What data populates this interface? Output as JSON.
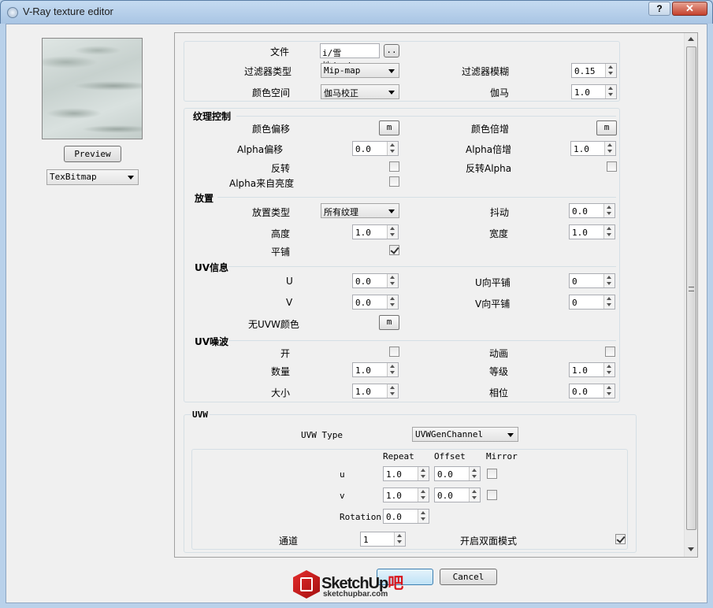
{
  "window": {
    "title": "V-Ray texture editor",
    "help_label": "?",
    "close_label": "✕"
  },
  "left": {
    "preview_label": "Preview",
    "type_value": "TexBitmap"
  },
  "file": {
    "label": "文件",
    "value": "i/雪地/a.jpg",
    "browse_label": ".."
  },
  "filter_type": {
    "label": "过滤器类型",
    "value": "Mip-map"
  },
  "filter_blur": {
    "label": "过滤器模糊",
    "value": "0.15"
  },
  "color_space": {
    "label": "颜色空间",
    "value": "伽马校正"
  },
  "gamma": {
    "label": "伽马",
    "value": "1.0"
  },
  "texture_control": {
    "title": "纹理控制",
    "color_offset": {
      "label": "颜色偏移",
      "btn": "m"
    },
    "color_mult": {
      "label": "颜色倍增",
      "btn": "m"
    },
    "alpha_offset": {
      "label": "Alpha偏移",
      "value": "0.0"
    },
    "alpha_mult": {
      "label": "Alpha倍增",
      "value": "1.0"
    },
    "invert": {
      "label": "反转"
    },
    "invert_alpha": {
      "label": "反转Alpha"
    },
    "alpha_from_intensity": {
      "label": "Alpha来自亮度"
    }
  },
  "placement": {
    "title": "放置",
    "type": {
      "label": "放置类型",
      "value": "所有纹理"
    },
    "jitter": {
      "label": "抖动",
      "value": "0.0"
    },
    "height": {
      "label": "高度",
      "value": "1.0"
    },
    "width": {
      "label": "宽度",
      "value": "1.0"
    },
    "tile": {
      "label": "平铺"
    }
  },
  "uv_info": {
    "title": "UV信息",
    "u": {
      "label": "U",
      "value": "0.0"
    },
    "u_tile": {
      "label": "U向平铺",
      "value": "0"
    },
    "v": {
      "label": "V",
      "value": "0.0"
    },
    "v_tile": {
      "label": "V向平铺",
      "value": "0"
    },
    "no_uvw_color": {
      "label": "无UVW颜色",
      "btn": "m"
    }
  },
  "uv_noise": {
    "title": "UV噪波",
    "on": {
      "label": "开"
    },
    "animate": {
      "label": "动画"
    },
    "amount": {
      "label": "数量",
      "value": "1.0"
    },
    "levels": {
      "label": "等级",
      "value": "1.0"
    },
    "size": {
      "label": "大小",
      "value": "1.0"
    },
    "phase": {
      "label": "相位",
      "value": "0.0"
    }
  },
  "uvw": {
    "title": "UVW",
    "type_label": "UVW Type",
    "type_value": "UVWGenChannel",
    "col_repeat": "Repeat",
    "col_offset": "Offset",
    "col_mirror": "Mirror",
    "u_label": "u",
    "u_repeat": "1.0",
    "u_offset": "0.0",
    "v_label": "v",
    "v_repeat": "1.0",
    "v_offset": "0.0",
    "rotation_label": "Rotation",
    "rotation_value": "0.0",
    "channel_label": "通道",
    "channel_value": "1",
    "double_sided_label": "开启双面模式"
  },
  "footer": {
    "cancel_label": "Cancel",
    "watermark_main": "SketchUp",
    "watermark_suffix": "吧",
    "watermark_url": "sketchupbar.com"
  }
}
